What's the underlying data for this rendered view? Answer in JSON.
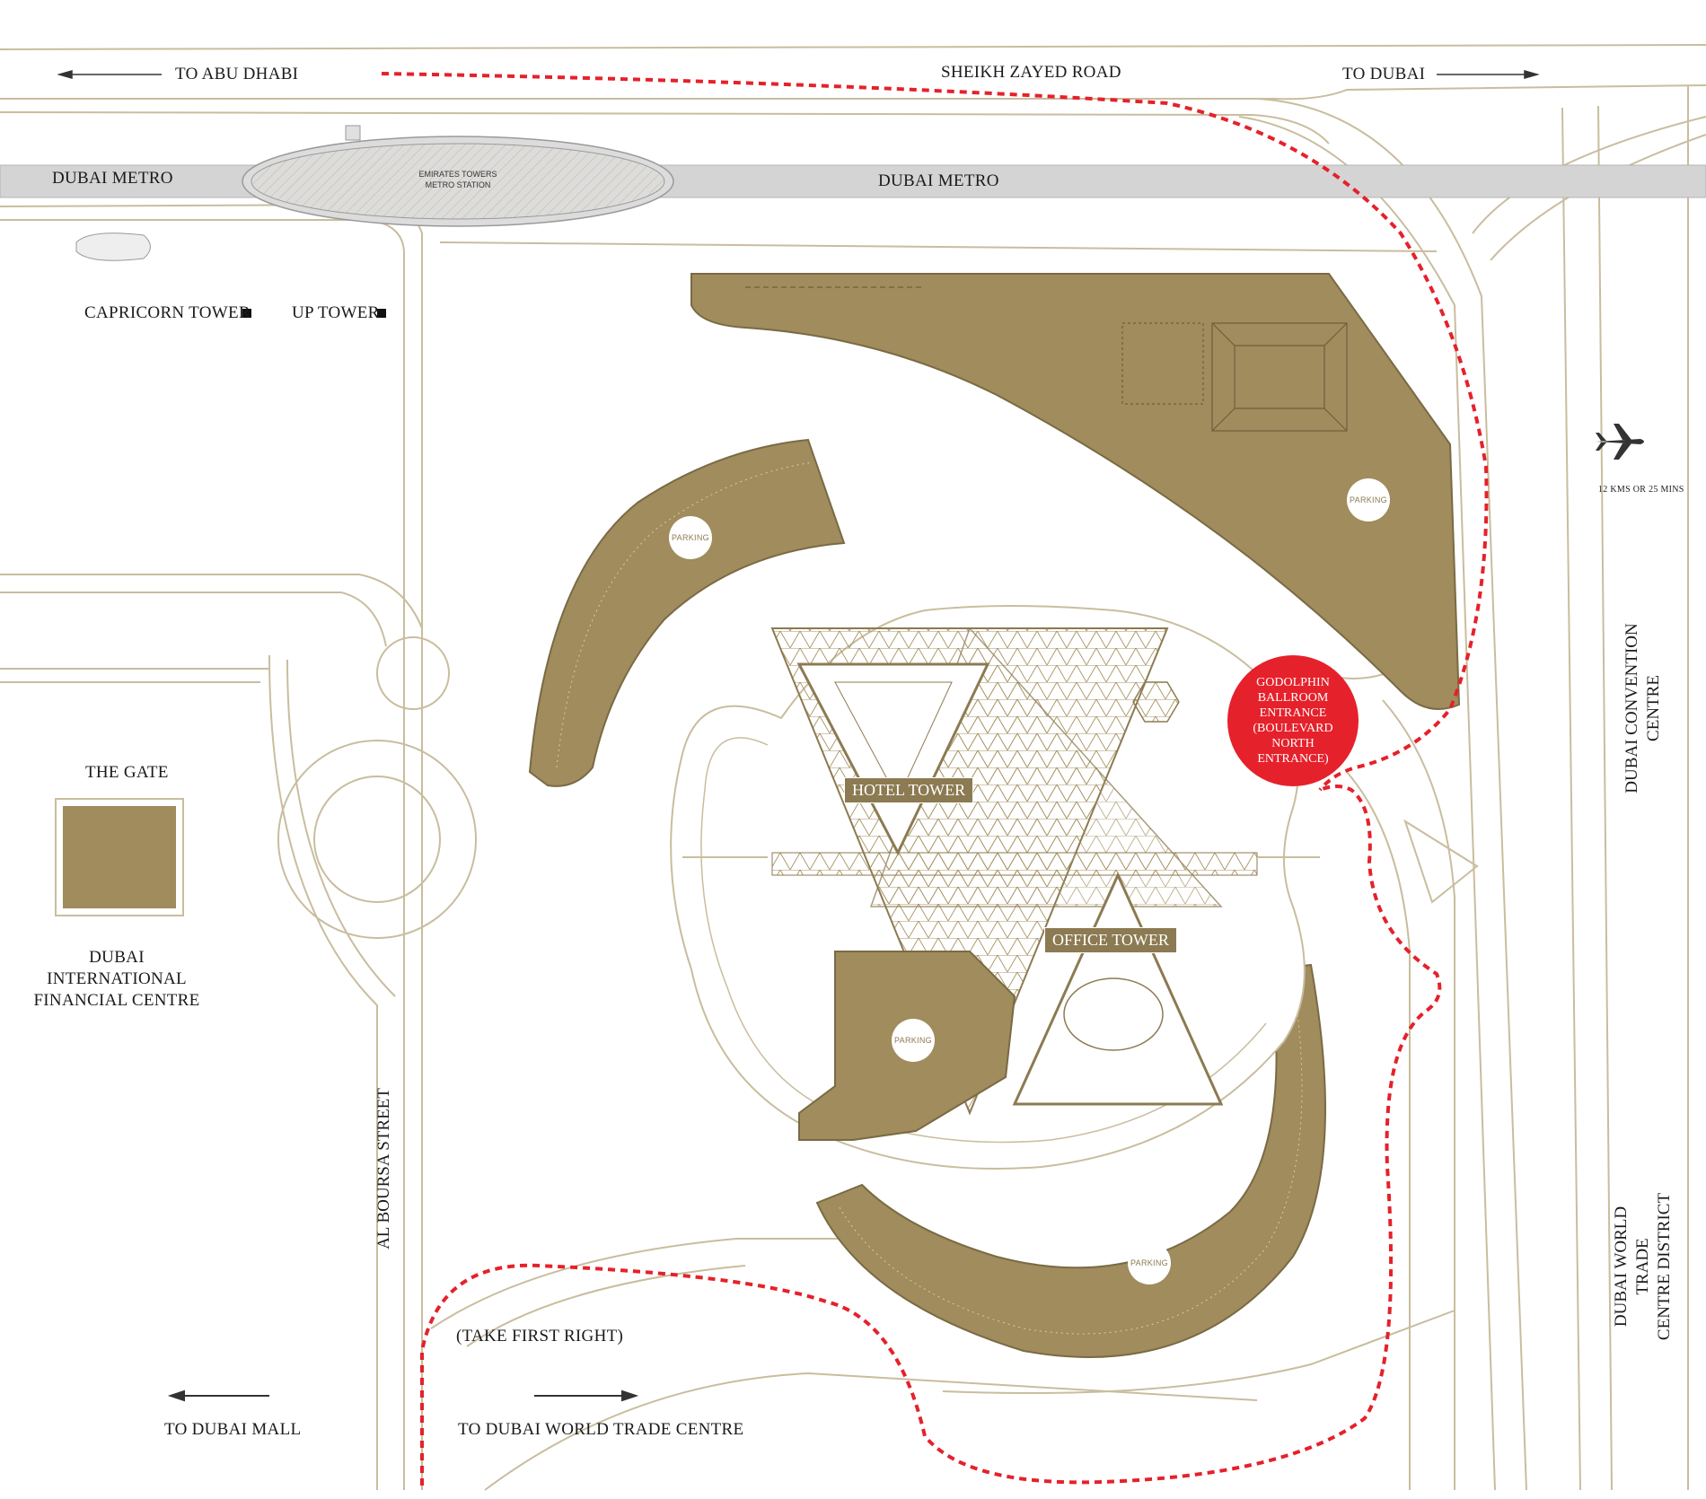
{
  "labels": {
    "to_abu_dhabi": "TO ABU DHABI",
    "sheikh_zayed_road": "SHEIKH ZAYED ROAD",
    "to_dubai": "TO DUBAI",
    "dubai_metro_left": "DUBAI METRO",
    "dubai_metro_right": "DUBAI METRO",
    "metro_station": "EMIRATES TOWERS\nMETRO STATION",
    "capricorn_tower": "CAPRICORN TOWER",
    "up_tower": "UP TOWER",
    "the_gate": "THE GATE",
    "difc": "DUBAI INTERNATIONAL\nFINANCIAL CENTRE",
    "al_boursa_street": "AL BOURSA STREET",
    "take_first_right": "(TAKE FIRST RIGHT)",
    "to_dubai_mall": "TO DUBAI MALL",
    "to_dwtc": "TO DUBAI WORLD TRADE CENTRE",
    "dubai_convention_centre": "DUBAI CONVENTION\nCENTRE",
    "dwtc_district": "DUBAI WORLD TRADE\nCENTRE DISTRICT",
    "airport_distance": "12 KMS OR 25 MINS",
    "hotel_tower": "HOTEL TOWER",
    "office_tower": "OFFICE TOWER",
    "parking": "PARKING",
    "entrance": "GODOLPHIN\nBALLROOM\nENTRANCE\n(BOULEVARD\nNORTH\nENTRANCE)"
  },
  "colors": {
    "gold": "#8c7a52",
    "gold_light": "#a59363",
    "road_line": "#c9bd9e",
    "route_red": "#e5212b",
    "metro_grey": "#d4d4d4"
  },
  "icons": {
    "airport": "airplane-icon",
    "marker": "square-marker-icon"
  }
}
